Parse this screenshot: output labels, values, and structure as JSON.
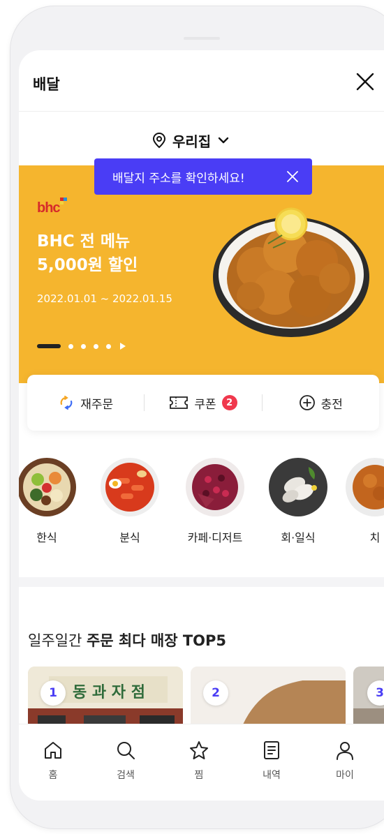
{
  "header": {
    "title": "배달"
  },
  "location": {
    "label": "우리집"
  },
  "tooltip": {
    "text": "배달지 주소를 확인하세요!"
  },
  "banner": {
    "brand": "bhc",
    "title_line1": "BHC 전 메뉴",
    "title_line2": "5,000원 할인",
    "period": "2022.01.01 ~ 2022.01.15",
    "background": "#f5b52e",
    "pager": {
      "current": 1,
      "total": 5
    }
  },
  "quick_actions": [
    {
      "label": "재주문",
      "icon": "reorder-icon"
    },
    {
      "label": "쿠폰",
      "icon": "coupon-icon",
      "badge": "2"
    },
    {
      "label": "충전",
      "icon": "plus-circle-icon"
    }
  ],
  "categories": [
    {
      "label": "한식"
    },
    {
      "label": "분식"
    },
    {
      "label": "카페·디저트"
    },
    {
      "label": "회·일식"
    },
    {
      "label": "치"
    }
  ],
  "top5": {
    "title_prefix": "일주일간 ",
    "title_bold": "주문 최다 매장 TOP5",
    "stores": [
      {
        "rank": "1",
        "sign": "동 과 자 점"
      },
      {
        "rank": "2"
      },
      {
        "rank": "3"
      }
    ]
  },
  "nav": [
    {
      "label": "홈",
      "icon": "home-icon"
    },
    {
      "label": "검색",
      "icon": "search-icon"
    },
    {
      "label": "찜",
      "icon": "star-icon"
    },
    {
      "label": "내역",
      "icon": "orders-icon"
    },
    {
      "label": "마이",
      "icon": "user-icon"
    }
  ],
  "colors": {
    "accent": "#4a3df5",
    "badge": "#f0384d",
    "banner": "#f5b52e"
  }
}
